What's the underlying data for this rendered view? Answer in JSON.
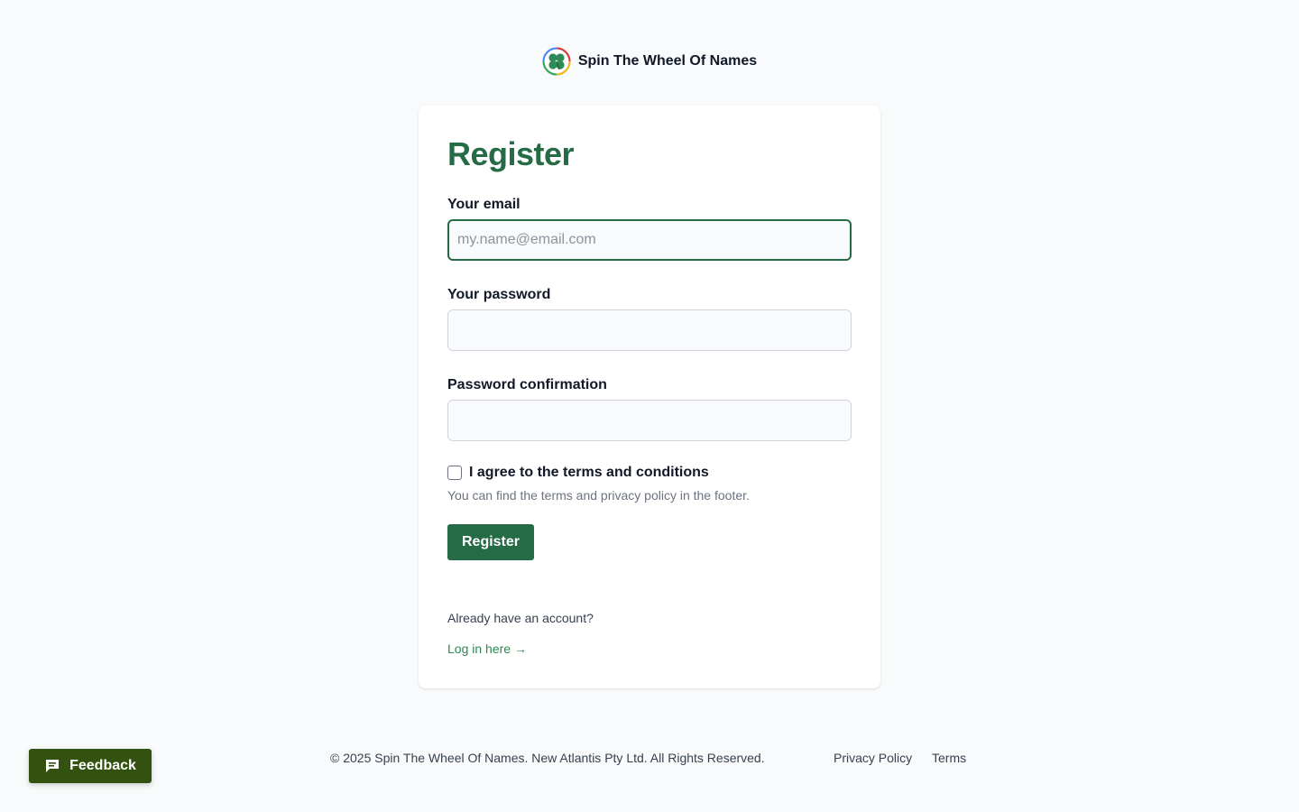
{
  "brand": {
    "name": "Spin The Wheel Of Names",
    "logo_icon": "four-leaf-clover-wheel-icon",
    "logo_colors": [
      "#e53935",
      "#fbbc05",
      "#34a853",
      "#4285f4"
    ]
  },
  "form": {
    "title": "Register",
    "email_label": "Your email",
    "email_placeholder": "my.name@email.com",
    "email_value": "",
    "password_label": "Your password",
    "password_value": "",
    "confirm_label": "Password confirmation",
    "confirm_value": "",
    "terms_label": "I agree to the terms and conditions",
    "terms_checked": false,
    "terms_hint": "You can find the terms and privacy policy in the footer.",
    "submit_label": "Register",
    "login_prompt": "Already have an account?",
    "login_link": "Log in here →"
  },
  "footer": {
    "copyright": "© 2025 Spin The Wheel Of Names. New Atlantis Pty Ltd. All Rights Reserved.",
    "privacy_link": "Privacy Policy",
    "terms_link": "Terms"
  },
  "feedback": {
    "label": "Feedback",
    "icon": "chat-bubble-icon"
  },
  "colors": {
    "accent": "#256b45",
    "link": "#2d8a55",
    "feedback_bg": "#33510f",
    "page_bg": "#f8fafb"
  }
}
